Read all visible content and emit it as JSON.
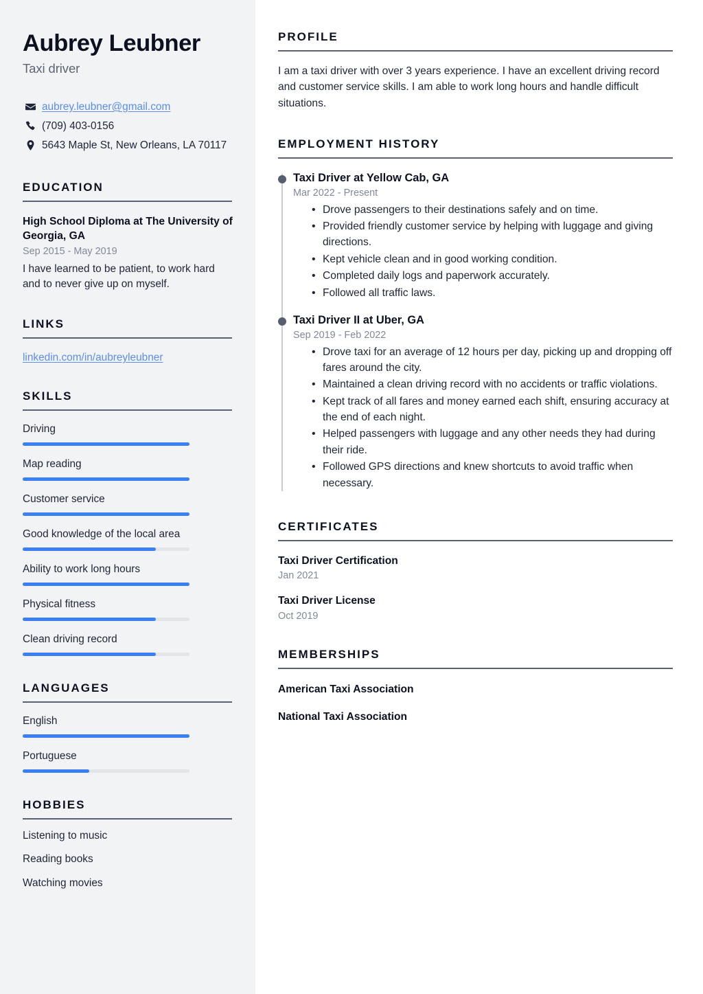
{
  "theme": {
    "sidebar_bg": "#f2f3f5",
    "text_dark": "#1f2437",
    "heading_dark": "#0d1021",
    "muted": "#82889a",
    "accent_blue": "#3b7ff5",
    "link_blue": "#5b8def",
    "rule": "#5a6175",
    "track": "#e3e5e9",
    "marker": "#565e72"
  },
  "header": {
    "name": "Aubrey Leubner",
    "job_title": "Taxi driver"
  },
  "contact": {
    "items": [
      {
        "icon": "envelope-icon",
        "text": "aubrey.leubner@gmail.com",
        "is_link": true
      },
      {
        "icon": "phone-icon",
        "text": "(709) 403-0156",
        "is_link": false
      },
      {
        "icon": "location-pin-icon",
        "text": "5643 Maple St, New Orleans, LA 70117",
        "is_link": false
      }
    ]
  },
  "sidebar": {
    "education": {
      "heading": "EDUCATION",
      "title": "High School Diploma at The University of Georgia, GA",
      "date": "Sep 2015 - May 2019",
      "description": "I have learned to be patient, to work hard and to never give up on myself."
    },
    "links": {
      "heading": "LINKS",
      "items": [
        {
          "label": "linkedin.com/in/aubreyleubner"
        }
      ]
    },
    "skills": {
      "heading": "SKILLS",
      "items": [
        {
          "label": "Driving",
          "level": 100
        },
        {
          "label": "Map reading",
          "level": 100
        },
        {
          "label": "Customer service",
          "level": 100
        },
        {
          "label": "Good knowledge of the local area",
          "level": 80
        },
        {
          "label": "Ability to work long hours",
          "level": 100
        },
        {
          "label": "Physical fitness",
          "level": 80
        },
        {
          "label": "Clean driving record",
          "level": 80
        }
      ]
    },
    "languages": {
      "heading": "LANGUAGES",
      "items": [
        {
          "label": "English",
          "level": 100
        },
        {
          "label": "Portuguese",
          "level": 40
        }
      ]
    },
    "hobbies": {
      "heading": "HOBBIES",
      "items": [
        {
          "label": "Listening to music"
        },
        {
          "label": "Reading books"
        },
        {
          "label": "Watching movies"
        }
      ]
    }
  },
  "main": {
    "profile": {
      "heading": "PROFILE",
      "text": "I am a taxi driver with over 3 years experience. I have an excellent driving record and customer service skills. I am able to work long hours and handle difficult situations."
    },
    "employment": {
      "heading": "EMPLOYMENT HISTORY",
      "jobs": [
        {
          "title": "Taxi Driver at Yellow Cab, GA",
          "date": "Mar 2022 - Present",
          "bullets": [
            "Drove passengers to their destinations safely and on time.",
            "Provided friendly customer service by helping with luggage and giving directions.",
            "Kept vehicle clean and in good working condition.",
            "Completed daily logs and paperwork accurately.",
            "Followed all traffic laws."
          ]
        },
        {
          "title": "Taxi Driver II at Uber, GA",
          "date": "Sep 2019 - Feb 2022",
          "bullets": [
            "Drove taxi for an average of 12 hours per day, picking up and dropping off fares around the city.",
            "Maintained a clean driving record with no accidents or traffic violations.",
            "Kept track of all fares and money earned each shift, ensuring accuracy at the end of each night.",
            "Helped passengers with luggage and any other needs they had during their ride.",
            "Followed GPS directions and knew shortcuts to avoid traffic when necessary."
          ]
        }
      ]
    },
    "certificates": {
      "heading": "CERTIFICATES",
      "items": [
        {
          "title": "Taxi Driver Certification",
          "date": "Jan 2021"
        },
        {
          "title": "Taxi Driver License",
          "date": "Oct 2019"
        }
      ]
    },
    "memberships": {
      "heading": "MEMBERSHIPS",
      "items": [
        {
          "label": "American Taxi Association"
        },
        {
          "label": "National Taxi Association"
        }
      ]
    }
  }
}
